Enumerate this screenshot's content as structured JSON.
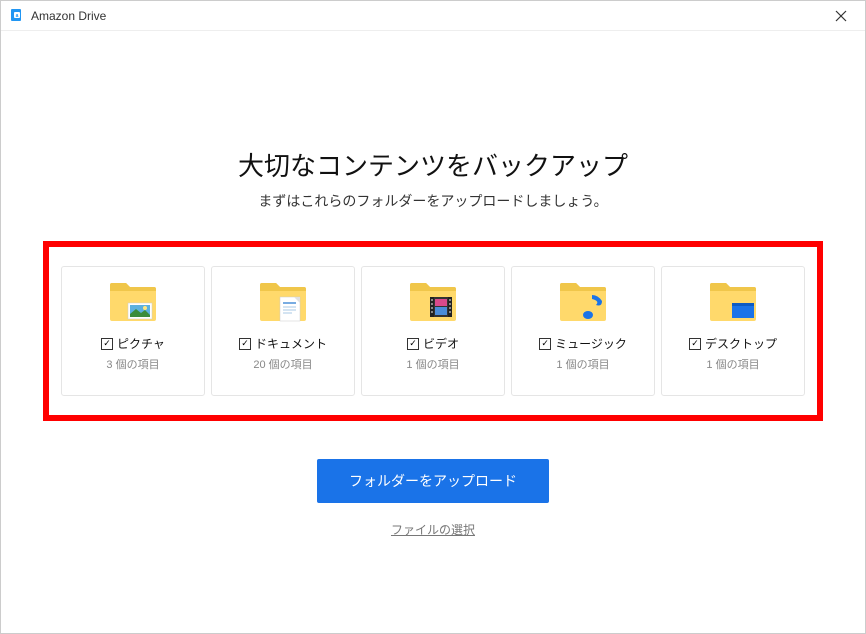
{
  "titlebar": {
    "app_name": "Amazon Drive"
  },
  "heading": "大切なコンテンツをバックアップ",
  "subheading": "まずはこれらのフォルダーをアップロードしましょう。",
  "cards": [
    {
      "label": "ピクチャ",
      "count": "3 個の項目",
      "icon": "pictures"
    },
    {
      "label": "ドキュメント",
      "count": "20 個の項目",
      "icon": "documents"
    },
    {
      "label": "ビデオ",
      "count": "1 個の項目",
      "icon": "videos"
    },
    {
      "label": "ミュージック",
      "count": "1 個の項目",
      "icon": "music"
    },
    {
      "label": "デスクトップ",
      "count": "1 個の項目",
      "icon": "desktop"
    }
  ],
  "upload_button": "フォルダーをアップロード",
  "file_select_link": "ファイルの選択"
}
